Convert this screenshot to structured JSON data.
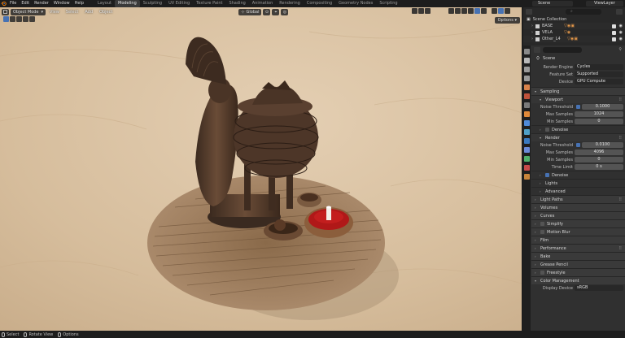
{
  "topbar": {
    "menus": [
      "File",
      "Edit",
      "Render",
      "Window",
      "Help"
    ],
    "workspaces": [
      "Layout",
      "Modeling",
      "Sculpting",
      "UV Editing",
      "Texture Paint",
      "Shading",
      "Animation",
      "Rendering",
      "Compositing",
      "Geometry Nodes",
      "Scripting"
    ],
    "active_workspace": "Modeling",
    "scene_name": "Scene",
    "view_layer": "ViewLayer"
  },
  "viewport": {
    "mode": "Object Mode",
    "menus": [
      "View",
      "Select",
      "Add",
      "Object"
    ],
    "transform_orientation": "Global",
    "options_label": "Options"
  },
  "outliner": {
    "title": "Scene Collection",
    "rows": [
      {
        "name": "BASE"
      },
      {
        "name": "VELA"
      },
      {
        "name": "Other_L4"
      }
    ]
  },
  "properties": {
    "scene_label": "Scene",
    "render_engine_label": "Render Engine",
    "render_engine": "Cycles",
    "feature_set_label": "Feature Set",
    "feature_set": "Supported",
    "device_label": "Device",
    "device": "GPU Compute",
    "sampling": "Sampling",
    "viewport": "Viewport",
    "noise_threshold_label": "Noise Threshold",
    "viewport_noise_threshold": "0.1000",
    "max_samples_label": "Max Samples",
    "viewport_max_samples": "1024",
    "min_samples_label": "Min Samples",
    "viewport_min_samples": "0",
    "denoise": "Denoise",
    "render": "Render",
    "render_noise_threshold": "0.0100",
    "render_max_samples": "4096",
    "render_min_samples": "0",
    "time_limit_label": "Time Limit",
    "time_limit": "0 s",
    "render_denoise": "Denoise",
    "lights": "Lights",
    "advanced": "Advanced",
    "panels": [
      "Light Paths",
      "Volumes",
      "Curves",
      "Simplify",
      "Motion Blur",
      "Film",
      "Performance",
      "Bake",
      "Grease Pencil",
      "Freestyle",
      "Color Management"
    ],
    "display_device_label": "Display Device",
    "display_device": "sRGB"
  },
  "status": {
    "select": "Select",
    "rotate": "Rotate View",
    "options": "Options"
  },
  "colors": {
    "accent": "#4772b3",
    "sand": "#d9c3a6",
    "wax_red": "#b01818"
  }
}
